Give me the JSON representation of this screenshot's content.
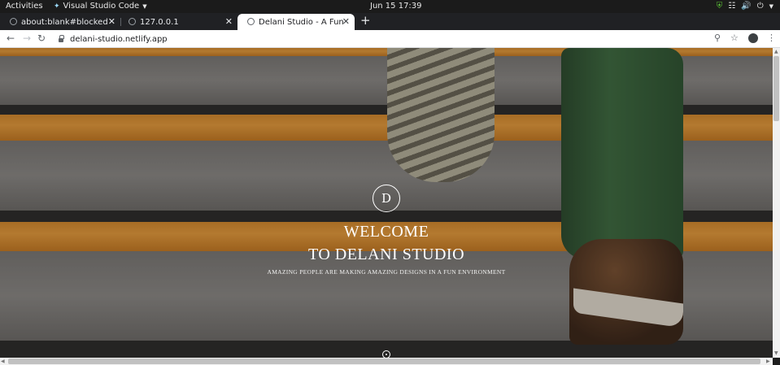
{
  "system_bar": {
    "activities": "Activities",
    "app_name": "Visual Studio Code",
    "clock": "Jun 15  17:39"
  },
  "browser": {
    "tabs": [
      {
        "title": "about:blank#blocked",
        "active": false
      },
      {
        "title": "127.0.0.1",
        "active": false
      },
      {
        "title": "Delani Studio - A Fun Envi",
        "active": true
      }
    ],
    "url": "delani-studio.netlify.app"
  },
  "page": {
    "logo_letter": "D",
    "welcome_line1": "WELCOME",
    "welcome_line2": "TO DELANI STUDIO",
    "tagline": "AMAZING PEOPLE ARE MAKING AMAZING DESIGNS IN A FUN ENVIRONMENT"
  },
  "colors": {
    "stair_orange": "#e99c3a",
    "trouser_green": "#3d6b3f",
    "hero_text": "#ffffff"
  }
}
